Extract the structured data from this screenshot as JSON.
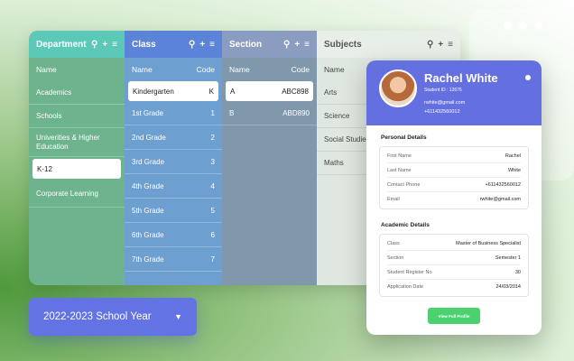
{
  "window": {
    "dots": [
      "dot",
      "dot",
      "dot"
    ]
  },
  "department": {
    "title": "Department",
    "column": "Name",
    "items": [
      "Academics",
      "Schools",
      "Univerities & Higher Education",
      "K-12",
      "Corporate Learning"
    ],
    "selected_index": 3
  },
  "class": {
    "title": "Class",
    "col_name": "Name",
    "col_code": "Code",
    "rows": [
      {
        "name": "Kindergarten",
        "code": "K"
      },
      {
        "name": "1st Grade",
        "code": "1"
      },
      {
        "name": "2nd Grade",
        "code": "2"
      },
      {
        "name": "3rd Grade",
        "code": "3"
      },
      {
        "name": "4th Grade",
        "code": "4"
      },
      {
        "name": "5th Grade",
        "code": "5"
      },
      {
        "name": "6th Grade",
        "code": "6"
      },
      {
        "name": "7th Grade",
        "code": "7"
      }
    ],
    "selected_index": 0
  },
  "section": {
    "title": "Section",
    "col_name": "Name",
    "col_code": "Code",
    "rows": [
      {
        "name": "A",
        "code": "ABC898"
      },
      {
        "name": "B",
        "code": "ABD890"
      }
    ],
    "selected_index": 0
  },
  "subjects": {
    "title": "Subjects",
    "column": "Name",
    "items": [
      "Arts",
      "Science",
      "Social Studie",
      "Maths"
    ]
  },
  "tools": {
    "search": "⚲",
    "add": "+",
    "menu": "≡"
  },
  "year_selector": {
    "label": "2022-2023 School Year",
    "caret": "▼"
  },
  "profile": {
    "name": "Rachel White",
    "student_id": "Student ID : 12676",
    "email": "rwhite@gmail.com",
    "phone": "+611432560012",
    "personal_title": "Personal Details",
    "personal": [
      {
        "k": "First Name",
        "v": "Rachel"
      },
      {
        "k": "Last Name",
        "v": "White"
      },
      {
        "k": "Contact Phone",
        "v": "+611432560012"
      },
      {
        "k": "Email",
        "v": "rwhite@gmail.com"
      }
    ],
    "academic_title": "Academic Details",
    "academic": [
      {
        "k": "Class",
        "v": "Master of Business Specialist"
      },
      {
        "k": "Section",
        "v": "Semester 1"
      },
      {
        "k": "Student Register No",
        "v": "30"
      },
      {
        "k": "Application Date",
        "v": "24/03/2014"
      }
    ],
    "button": "View Full Profile"
  }
}
